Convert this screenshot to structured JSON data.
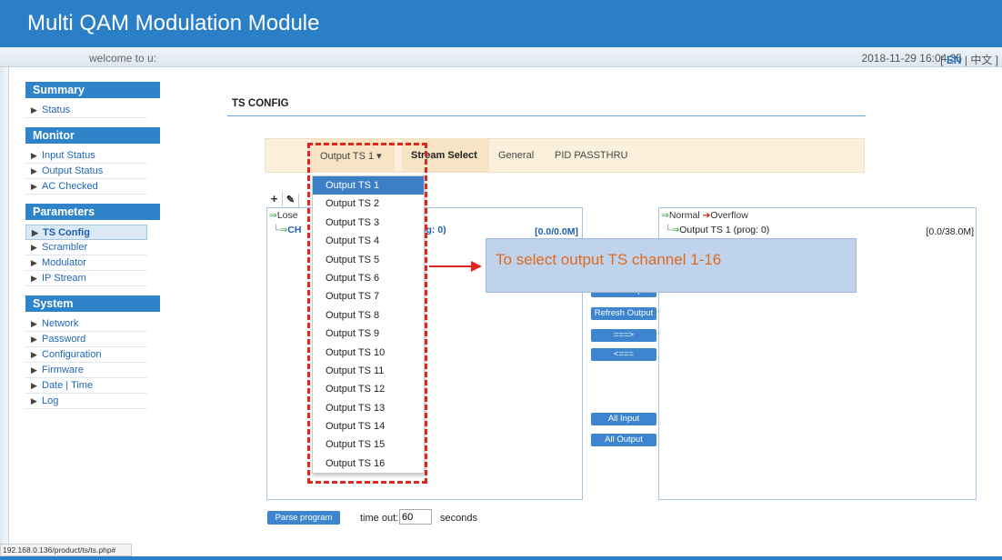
{
  "header": {
    "title": "Multi QAM Modulation Module"
  },
  "topbar": {
    "welcome": "welcome to u:",
    "datetime": "2018-11-29 16:04:35",
    "lang_en": "EN",
    "lang_zh": "中文"
  },
  "sidebar": {
    "summary": {
      "title": "Summary",
      "items": [
        "Status"
      ]
    },
    "monitor": {
      "title": "Monitor",
      "items": [
        "Input Status",
        "Output Status",
        "AC Checked"
      ]
    },
    "parameters": {
      "title": "Parameters",
      "items": [
        "TS Config",
        "Scrambler",
        "Modulator",
        "IP Stream"
      ]
    },
    "system": {
      "title": "System",
      "items": [
        "Network",
        "Password",
        "Configuration",
        "Firmware",
        "Date | Time",
        "Log"
      ]
    }
  },
  "page": {
    "title": "TS CONFIG"
  },
  "tabs": {
    "output_select": "Output TS 1",
    "stream_select": "Stream Select",
    "general": "General",
    "pid_passthru": "PID PASSTHRU"
  },
  "left_panel": {
    "legend_lose": "Lose",
    "channel_label": "CH",
    "prog": "rog: 0)",
    "rate": "[0.0/0.0M]"
  },
  "right_panel": {
    "legend_normal": "Normal",
    "legend_overflow": "Overflow",
    "output_row": "Output TS 1 (prog: 0)",
    "rate": "[0.0/38.0M]"
  },
  "buttons": {
    "refresh_input": "Refresh Input",
    "refresh_output": "Refresh Output",
    "move_right": "===>",
    "move_left": "<===",
    "all_input": "All Input",
    "all_output": "All Output",
    "parse_program": "Parse program"
  },
  "timeout": {
    "label": "time out:",
    "value": "60",
    "unit": "seconds"
  },
  "dropdown": {
    "selected": "Output TS 1",
    "options": [
      "Output TS 1",
      "Output TS 2",
      "Output TS 3",
      "Output TS 4",
      "Output TS 5",
      "Output TS 6",
      "Output TS 7",
      "Output TS 8",
      "Output TS 9",
      "Output TS 10",
      "Output TS 11",
      "Output TS 12",
      "Output TS 13",
      "Output TS 14",
      "Output TS 15",
      "Output TS 16"
    ]
  },
  "callout": {
    "text": "To select output TS channel 1-16"
  },
  "statusbar": {
    "url": "192.168.0.136/product/ts/ts.php#"
  },
  "colors": {
    "brand": "#2b7fc7",
    "annotation_red": "#e0261f",
    "callout_text": "#e06b1e",
    "callout_bg": "#bfd3ec"
  }
}
